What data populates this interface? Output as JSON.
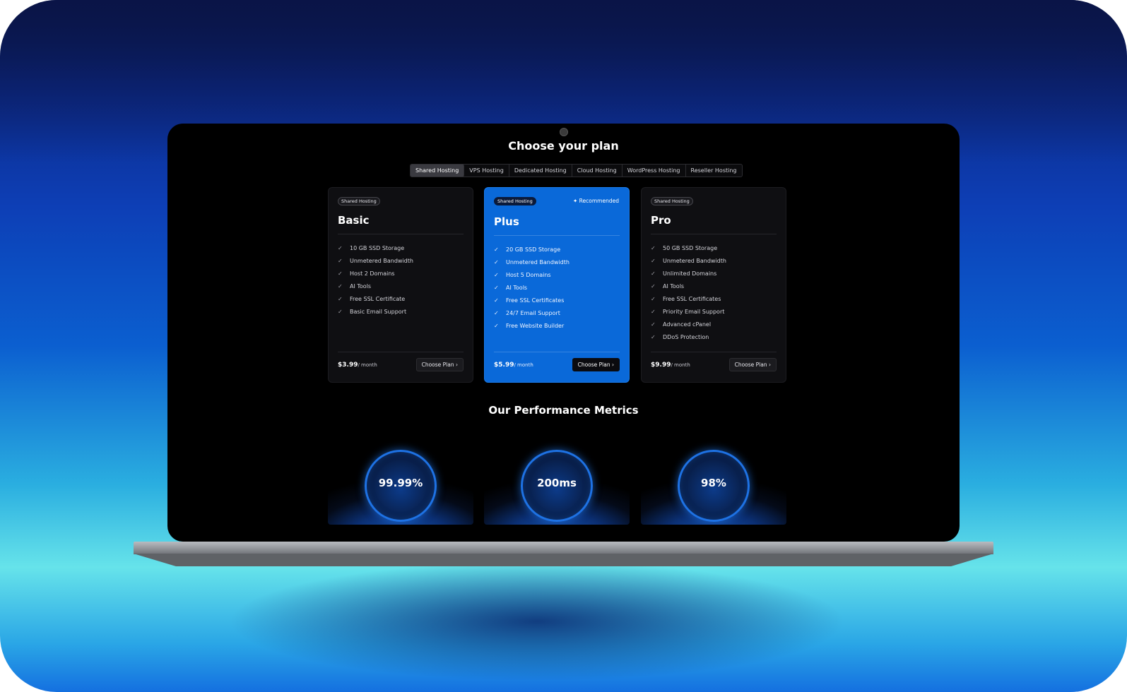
{
  "page": {
    "title": "Choose your plan",
    "tabs": [
      "Shared Hosting",
      "VPS Hosting",
      "Dedicated Hosting",
      "Cloud Hosting",
      "WordPress Hosting",
      "Reseller Hosting"
    ],
    "active_tab": "Shared Hosting"
  },
  "plans": [
    {
      "badge": "Shared Hosting",
      "name": "Basic",
      "features": [
        "10 GB SSD Storage",
        "Unmetered Bandwidth",
        "Host 2 Domains",
        "AI Tools",
        "Free SSL Certificate",
        "Basic Email Support"
      ],
      "price": "$3.99",
      "period": "/ month",
      "button": "Choose Plan"
    },
    {
      "badge": "Shared Hosting",
      "name": "Plus",
      "recommended": "Recommended",
      "features": [
        "20 GB SSD Storage",
        "Unmetered Bandwidth",
        "Host 5 Domains",
        "AI Tools",
        "Free SSL Certificates",
        "24/7 Email Support",
        "Free Website Builder"
      ],
      "price": "$5.99",
      "period": "/ month",
      "button": "Choose Plan"
    },
    {
      "badge": "Shared Hosting",
      "name": "Pro",
      "features": [
        "50 GB SSD Storage",
        "Unmetered Bandwidth",
        "Unlimited Domains",
        "AI Tools",
        "Free SSL Certificates",
        "Priority Email Support",
        "Advanced cPanel",
        "DDoS Protection"
      ],
      "price": "$9.99",
      "period": "/ month",
      "button": "Choose Plan"
    }
  ],
  "metrics": {
    "title": "Our Performance Metrics",
    "values": [
      "99.99%",
      "200ms",
      "98%"
    ]
  },
  "colors": {
    "accent": "#0a69d9",
    "ring": "#1e72e4"
  },
  "icons": {
    "check": "check-icon",
    "sparkle": "sparkle-icon",
    "chevron": "chevron-right-icon",
    "camera": "camera-icon"
  }
}
